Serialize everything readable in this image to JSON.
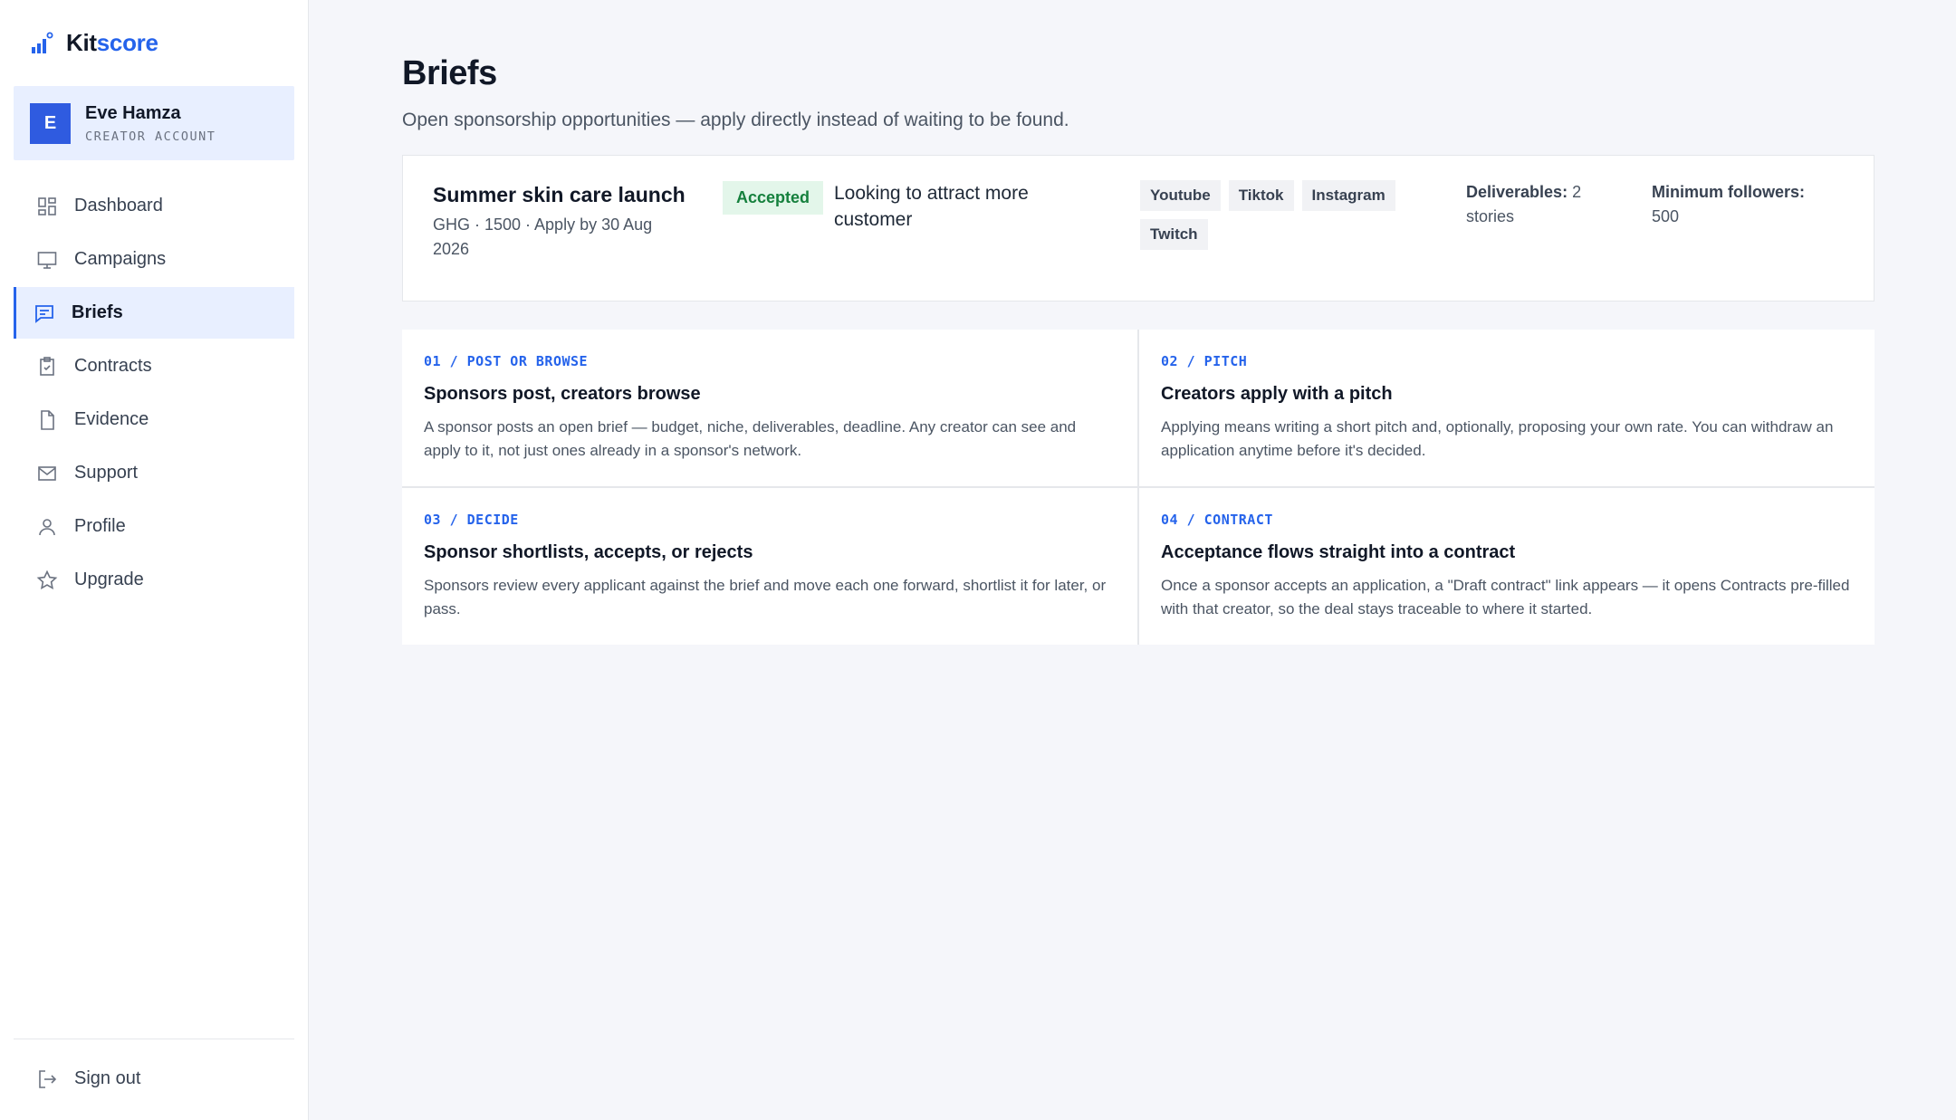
{
  "brand": {
    "part1": "Kit",
    "part2": "score"
  },
  "user": {
    "initial": "E",
    "name": "Eve Hamza",
    "role": "CREATOR ACCOUNT"
  },
  "nav": [
    {
      "label": "Dashboard",
      "icon": "dashboard-icon"
    },
    {
      "label": "Campaigns",
      "icon": "monitor-icon"
    },
    {
      "label": "Briefs",
      "icon": "message-icon",
      "active": true
    },
    {
      "label": "Contracts",
      "icon": "clipboard-check-icon"
    },
    {
      "label": "Evidence",
      "icon": "file-icon"
    },
    {
      "label": "Support",
      "icon": "mail-icon"
    },
    {
      "label": "Profile",
      "icon": "user-icon"
    },
    {
      "label": "Upgrade",
      "icon": "star-icon"
    }
  ],
  "signout": {
    "label": "Sign out",
    "icon": "logout-icon"
  },
  "page": {
    "title": "Briefs",
    "subtitle": "Open sponsorship opportunities — apply directly instead of waiting to be found."
  },
  "brief": {
    "title": "Summer skin care launch",
    "meta": "GHG · 1500 · Apply by 30 Aug 2026",
    "status": "Accepted",
    "description": "Looking to attract more customer",
    "platforms": [
      "Youtube",
      "Tiktok",
      "Instagram",
      "Twitch"
    ],
    "deliverables_label": "Deliverables:",
    "deliverables_value": "2 stories",
    "min_followers_label": "Minimum followers:",
    "min_followers_value": "500"
  },
  "steps": [
    {
      "label": "01 / POST OR BROWSE",
      "title": "Sponsors post, creators browse",
      "text": "A sponsor posts an open brief — budget, niche, deliverables, deadline. Any creator can see and apply to it, not just ones already in a sponsor's network."
    },
    {
      "label": "02 / PITCH",
      "title": "Creators apply with a pitch",
      "text": "Applying means writing a short pitch and, optionally, proposing your own rate. You can withdraw an application anytime before it's decided."
    },
    {
      "label": "03 / DECIDE",
      "title": "Sponsor shortlists, accepts, or rejects",
      "text": "Sponsors review every applicant against the brief and move each one forward, shortlist it for later, or pass."
    },
    {
      "label": "04 / CONTRACT",
      "title": "Acceptance flows straight into a contract",
      "text": "Once a sponsor accepts an application, a \"Draft contract\" link appears — it opens Contracts pre-filled with that creator, so the deal stays traceable to where it started."
    }
  ]
}
